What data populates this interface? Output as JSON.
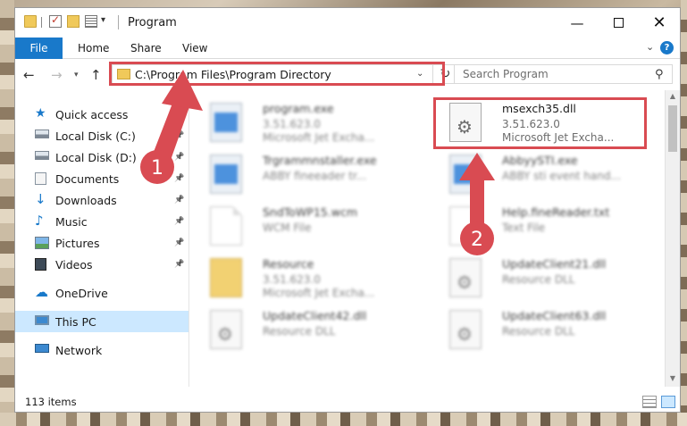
{
  "window": {
    "title": "Program",
    "controls": {
      "minimize": "—",
      "close": "✕"
    }
  },
  "ribbon": {
    "tabs": [
      "File",
      "Home",
      "Share",
      "View"
    ],
    "help": "?"
  },
  "address": {
    "path": "C:\\Program Files\\Program Directory",
    "search_placeholder": "Search Program"
  },
  "navpane": {
    "items": [
      {
        "label": "Quick access",
        "icon": "star-icon",
        "pinned": false
      },
      {
        "label": "Local Disk (C:)",
        "icon": "drive-icon",
        "pinned": true
      },
      {
        "label": "Local Disk (D:)",
        "icon": "drive-icon",
        "pinned": true
      },
      {
        "label": "Documents",
        "icon": "documents-icon",
        "pinned": true
      },
      {
        "label": "Downloads",
        "icon": "download-icon",
        "pinned": true
      },
      {
        "label": "Music",
        "icon": "music-icon",
        "pinned": true
      },
      {
        "label": "Pictures",
        "icon": "pictures-icon",
        "pinned": true
      },
      {
        "label": "Videos",
        "icon": "videos-icon",
        "pinned": true
      },
      {
        "label": "OneDrive",
        "icon": "cloud-icon",
        "pinned": false
      },
      {
        "label": "This PC",
        "icon": "computer-icon",
        "pinned": false,
        "selected": true
      },
      {
        "label": "Network",
        "icon": "network-icon",
        "pinned": false
      }
    ]
  },
  "files": [
    {
      "name": "program.exe",
      "meta1": "3.51.623.0",
      "meta2": "Microsoft Jet Excha...",
      "icon": "exe-icon",
      "blurred": true
    },
    {
      "name": "msexch35.dll",
      "meta1": "3.51.623.0",
      "meta2": "Microsoft Jet Excha...",
      "icon": "dll-icon",
      "blurred": false,
      "highlighted": true
    },
    {
      "name": "Trgrammnstaller.exe",
      "meta1": "ABBY fineeader tr...",
      "meta2": "",
      "icon": "exe-icon",
      "blurred": true
    },
    {
      "name": "AbbyySTI.exe",
      "meta1": "ABBY sti event hand...",
      "meta2": "",
      "icon": "exe-icon",
      "blurred": true
    },
    {
      "name": "SndToWP15.wcm",
      "meta1": "WCM File",
      "meta2": "",
      "icon": "document-icon",
      "blurred": true
    },
    {
      "name": "Help.fineReader.txt",
      "meta1": "Text File",
      "meta2": "",
      "icon": "document-icon",
      "blurred": true
    },
    {
      "name": "Resource",
      "meta1": "3.51.623.0",
      "meta2": "Microsoft Jet Excha...",
      "icon": "folder-icon",
      "blurred": true
    },
    {
      "name": "UpdateClient21.dll",
      "meta1": "Resource DLL",
      "meta2": "",
      "icon": "dll-icon",
      "blurred": true
    },
    {
      "name": "UpdateClient42.dll",
      "meta1": "Resource DLL",
      "meta2": "",
      "icon": "dll-icon",
      "blurred": true
    },
    {
      "name": "UpdateClient63.dll",
      "meta1": "Resource DLL",
      "meta2": "",
      "icon": "dll-icon",
      "blurred": true
    }
  ],
  "status": {
    "count": "113 items"
  },
  "annotations": {
    "step1": "1",
    "step2": "2",
    "color": "#d94b52"
  }
}
